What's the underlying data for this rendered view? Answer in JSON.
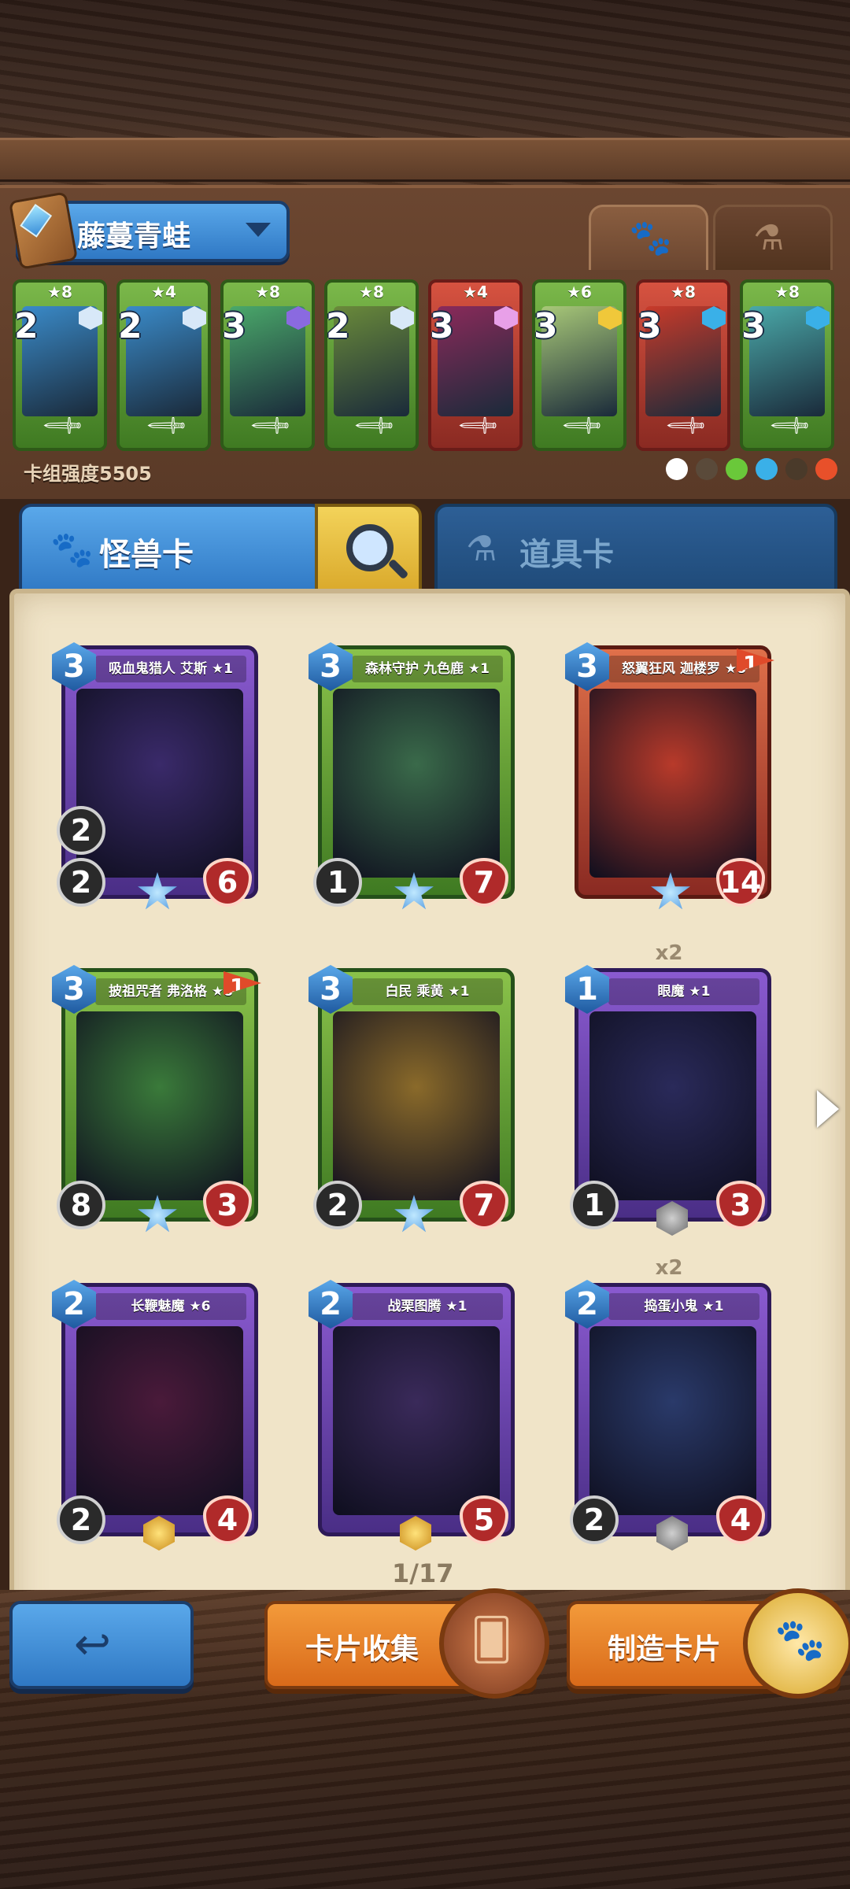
{
  "deck": {
    "name": "藤蔓青蛙",
    "power_label": "卡组强度5505",
    "cards": [
      {
        "stars": "★8",
        "cost": "2",
        "color": "green",
        "art": "#3a8ac8",
        "gem": "#d8e8f8"
      },
      {
        "stars": "★4",
        "cost": "2",
        "color": "green",
        "art": "#3a8ac8",
        "gem": "#d8e8f8"
      },
      {
        "stars": "★8",
        "cost": "3",
        "color": "green",
        "art": "#4aa86a",
        "gem": "#8a6ae0"
      },
      {
        "stars": "★8",
        "cost": "2",
        "color": "green",
        "art": "#6a8a3a",
        "gem": "#d8e8f8"
      },
      {
        "stars": "★4",
        "cost": "3",
        "color": "red",
        "art": "#8a2a5a",
        "gem": "#e8a0e8"
      },
      {
        "stars": "★6",
        "cost": "3",
        "color": "green",
        "art": "#a8c878",
        "gem": "#f0c83a"
      },
      {
        "stars": "★8",
        "cost": "3",
        "color": "red",
        "art": "#c83a2a",
        "gem": "#3ab0e8"
      },
      {
        "stars": "★8",
        "cost": "3",
        "color": "green",
        "art": "#4aa8a8",
        "gem": "#3ab0e8"
      }
    ],
    "elements": [
      "#ffffff",
      "#5a4a3a",
      "#6ac83a",
      "#3ab0e8",
      "#4a3a2a",
      "#e8502a"
    ]
  },
  "tabs": {
    "monster": "怪兽卡",
    "item": "道具卡"
  },
  "collection": [
    {
      "title": "吸血鬼猎人 艾斯 ★1",
      "cost": "3",
      "atk": "2",
      "extra": "2",
      "hp": "6",
      "color": "purple",
      "art": "#3a2a6a",
      "rank": "star",
      "flag": "",
      "dup": ""
    },
    {
      "title": "森林守护 九色鹿 ★1",
      "cost": "3",
      "atk": "1",
      "extra": "",
      "hp": "7",
      "color": "green",
      "art": "#3a6a4a",
      "rank": "star",
      "flag": "",
      "dup": ""
    },
    {
      "title": "怒翼狂风 迦楼罗 ★8",
      "cost": "3",
      "atk": "",
      "extra": "",
      "hp": "14",
      "color": "red",
      "art": "#b83a2a",
      "rank": "star",
      "flag": "1",
      "dup": ""
    },
    {
      "title": "披祖咒者 弗洛格 ★8",
      "cost": "3",
      "atk": "8",
      "extra": "",
      "hp": "3",
      "color": "green",
      "art": "#3a7a3a",
      "rank": "star",
      "flag": "1",
      "dup": ""
    },
    {
      "title": "白民 乘黄 ★1",
      "cost": "3",
      "atk": "2",
      "extra": "",
      "hp": "7",
      "color": "green",
      "art": "#8a6a2a",
      "rank": "star",
      "flag": "",
      "dup": ""
    },
    {
      "title": "眼魔 ★1",
      "cost": "1",
      "atk": "1",
      "extra": "",
      "hp": "3",
      "color": "purple",
      "art": "#2a2a5a",
      "rank": "grey",
      "flag": "",
      "dup": "x2"
    },
    {
      "title": "长鞭魅魔 ★6",
      "cost": "2",
      "atk": "2",
      "extra": "",
      "hp": "4",
      "color": "purple",
      "art": "#4a1a3a",
      "rank": "gold",
      "flag": "",
      "dup": ""
    },
    {
      "title": "战栗图腾 ★1",
      "cost": "2",
      "atk": "",
      "extra": "",
      "hp": "5",
      "color": "purple",
      "art": "#3a2a5a",
      "rank": "gold",
      "flag": "",
      "dup": ""
    },
    {
      "title": "捣蛋小鬼 ★1",
      "cost": "2",
      "atk": "2",
      "extra": "",
      "hp": "4",
      "color": "purple",
      "art": "#2a3a6a",
      "rank": "grey",
      "flag": "",
      "dup": "x2"
    }
  ],
  "page": "1/17",
  "buttons": {
    "collect": "卡片收集",
    "craft": "制造卡片"
  }
}
